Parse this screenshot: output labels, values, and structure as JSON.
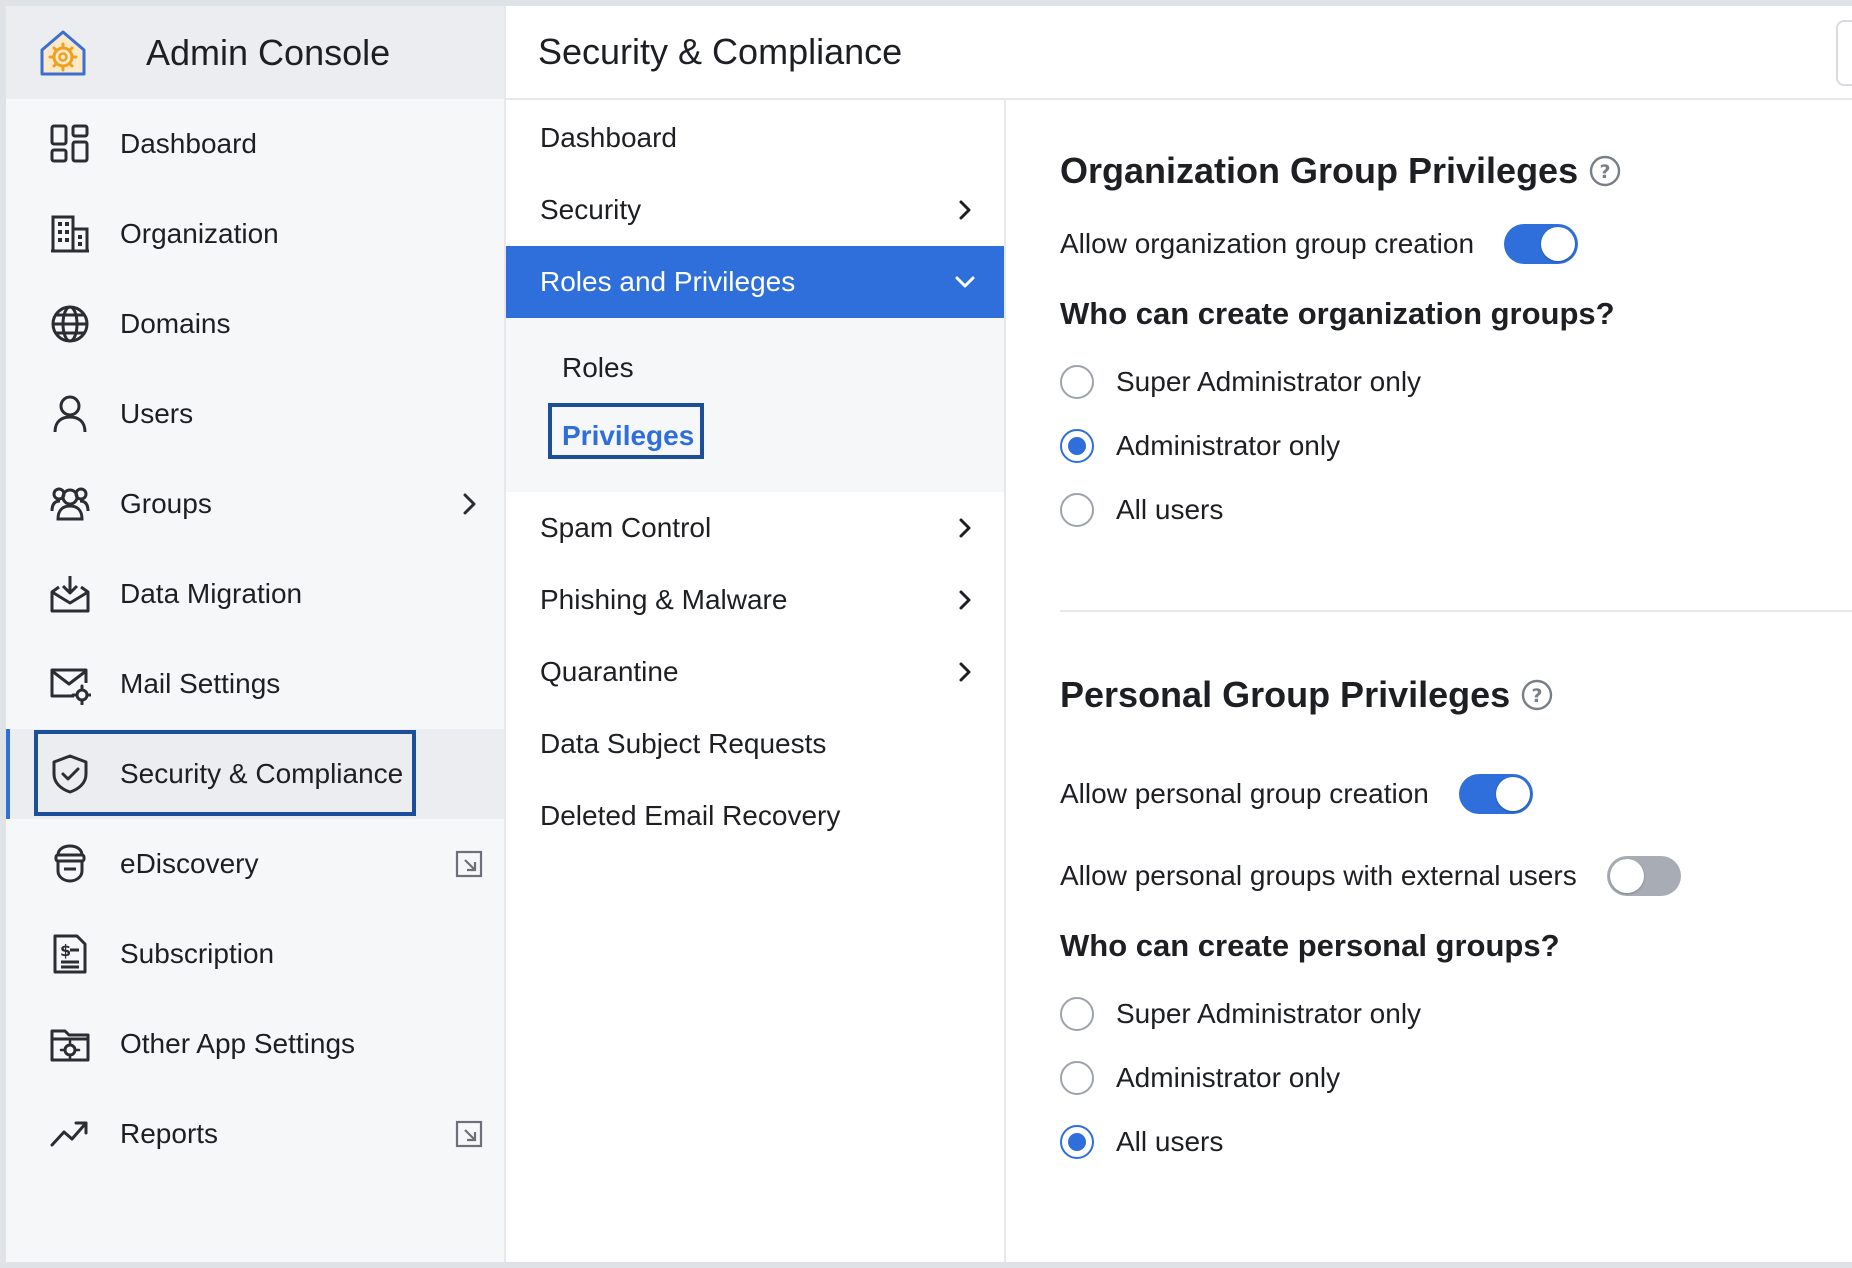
{
  "brand": {
    "title": "Admin Console",
    "logo_icon": "admin-gear-house-icon",
    "accent": "#f0a020"
  },
  "sidebar": {
    "items": [
      {
        "label": "Dashboard",
        "icon": "dashboard-icon"
      },
      {
        "label": "Organization",
        "icon": "building-icon"
      },
      {
        "label": "Domains",
        "icon": "globe-icon"
      },
      {
        "label": "Users",
        "icon": "user-icon"
      },
      {
        "label": "Groups",
        "icon": "groups-icon",
        "trail": "chevron-right-icon"
      },
      {
        "label": "Data Migration",
        "icon": "inbox-download-icon"
      },
      {
        "label": "Mail Settings",
        "icon": "mail-settings-icon"
      },
      {
        "label": "Security & Compliance",
        "icon": "shield-check-icon",
        "active": true
      },
      {
        "label": "eDiscovery",
        "icon": "ediscovery-icon",
        "trail": "external-link-icon"
      },
      {
        "label": "Subscription",
        "icon": "invoice-icon"
      },
      {
        "label": "Other App Settings",
        "icon": "folder-settings-icon"
      },
      {
        "label": "Reports",
        "icon": "trend-icon",
        "trail": "external-link-icon"
      }
    ]
  },
  "header": {
    "title": "Security & Compliance"
  },
  "submenu": {
    "items": [
      {
        "label": "Dashboard"
      },
      {
        "label": "Security",
        "chevron": "right"
      },
      {
        "label": "Roles and Privileges",
        "chevron": "down",
        "active": true
      },
      {
        "label": "Spam Control",
        "chevron": "right"
      },
      {
        "label": "Phishing & Malware",
        "chevron": "right"
      },
      {
        "label": "Quarantine",
        "chevron": "right"
      },
      {
        "label": "Data Subject Requests"
      },
      {
        "label": "Deleted Email Recovery"
      }
    ],
    "roles_sub": [
      {
        "label": "Roles"
      },
      {
        "label": "Privileges",
        "selected": true
      }
    ]
  },
  "org_section": {
    "title": "Organization Group Privileges",
    "toggle_label": "Allow organization group creation",
    "toggle_on": true,
    "question": "Who can create organization groups?",
    "options": [
      "Super Administrator only",
      "Administrator only",
      "All users"
    ],
    "selected": "Administrator only"
  },
  "personal_section": {
    "title": "Personal Group Privileges",
    "toggle_label": "Allow personal group creation",
    "toggle_on": true,
    "external_label": "Allow personal groups with external users",
    "external_on": false,
    "question": "Who can create personal groups?",
    "options": [
      "Super Administrator only",
      "Administrator only",
      "All users"
    ],
    "selected": "All users"
  },
  "colors": {
    "primary": "#2f6fdb",
    "focus_outline": "#1b4f9a",
    "toggle_off": "#a8adb5"
  }
}
